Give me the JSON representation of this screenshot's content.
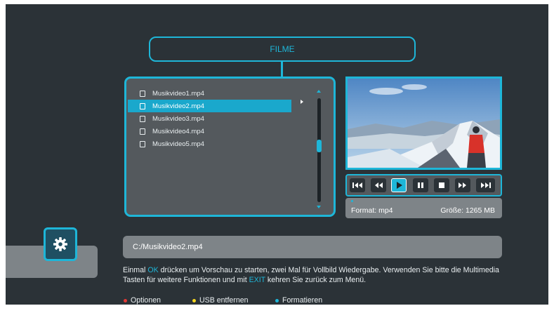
{
  "title": "FILME",
  "files": [
    {
      "name": "Musikvideo1.mp4",
      "selected": false
    },
    {
      "name": "Musikvideo2.mp4",
      "selected": true
    },
    {
      "name": "Musikvideo3.mp4",
      "selected": false
    },
    {
      "name": "Musikvideo4.mp4",
      "selected": false
    },
    {
      "name": "Musikvideo5.mp4",
      "selected": false
    }
  ],
  "scroll_position": 0.45,
  "controls": [
    {
      "name": "skip-back-icon",
      "active": false
    },
    {
      "name": "rewind-icon",
      "active": false
    },
    {
      "name": "play-icon",
      "active": true
    },
    {
      "name": "pause-icon",
      "active": false
    },
    {
      "name": "stop-icon",
      "active": false
    },
    {
      "name": "fast-forward-icon",
      "active": false
    },
    {
      "name": "skip-forward-icon",
      "active": false
    }
  ],
  "info": {
    "format": "Format: mp4",
    "size": "Größe: 1265 MB"
  },
  "path": "C:/Musikvideo2.mp4",
  "help": {
    "part1": "Einmal ",
    "ok": "OK",
    "part2": " drücken um Vorschau zu starten, zwei Mal für Vollbild Wiedergabe. Verwenden Sie bitte die Multimedia Tasten für weitere Funktionen und mit ",
    "exit": "EXIT",
    "part3": " kehren Sie zurück zum Menü."
  },
  "legend": [
    {
      "label": "Optionen",
      "color": "#e53935"
    },
    {
      "label": "USB entfernen",
      "color": "#f5d51e"
    },
    {
      "label": "Formatieren",
      "color": "#1eb6d8"
    }
  ],
  "colors": {
    "accent": "#1eb6d8",
    "background": "#2b3237",
    "panel": "#54595d",
    "bar": "#7e8488"
  }
}
